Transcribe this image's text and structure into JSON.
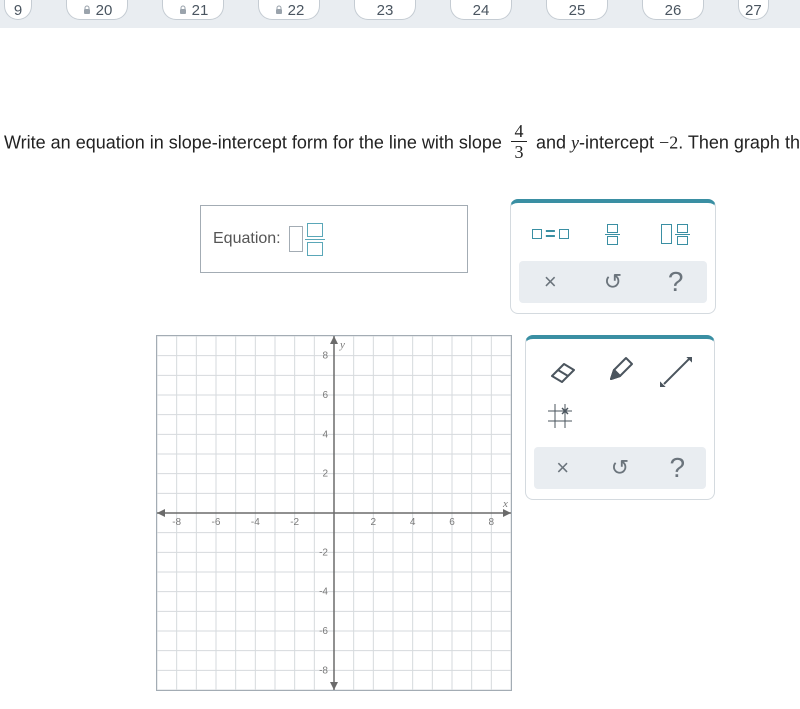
{
  "nav": {
    "items": [
      "9",
      "20",
      "21",
      "22",
      "23",
      "24",
      "25",
      "26",
      "27"
    ],
    "locked": [
      false,
      true,
      true,
      true,
      false,
      false,
      false,
      false,
      false
    ]
  },
  "question": {
    "part1": "Write an equation in slope-intercept form for the line with slope ",
    "slope_num": "4",
    "slope_den": "3",
    "part2": " and ",
    "yvar": "y",
    "part3": "-intercept ",
    "intercept": "−2",
    "part4": ". Then graph the line."
  },
  "equation_box": {
    "label": "Equation:"
  },
  "eq_tools": {
    "clear": "×",
    "undo": "↺",
    "help": "?"
  },
  "graph_tools": {
    "clear": "×",
    "undo": "↺",
    "help": "?"
  },
  "graph": {
    "x_ticks": [
      -8,
      -6,
      -4,
      -2,
      2,
      4,
      6,
      8
    ],
    "y_ticks": [
      8,
      6,
      4,
      2,
      -2,
      -4,
      -6,
      -8
    ],
    "x_axis_label": "x",
    "y_axis_label": "y"
  },
  "chart_data": {
    "type": "line",
    "title": "",
    "xlabel": "x",
    "ylabel": "y",
    "xlim": [
      -9,
      9
    ],
    "ylim": [
      -9,
      9
    ],
    "x_ticks": [
      -8,
      -6,
      -4,
      -2,
      0,
      2,
      4,
      6,
      8
    ],
    "y_ticks": [
      -8,
      -6,
      -4,
      -2,
      0,
      2,
      4,
      6,
      8
    ],
    "series": [],
    "note": "Blank coordinate grid; user is expected to plot y = (4/3)x - 2."
  }
}
